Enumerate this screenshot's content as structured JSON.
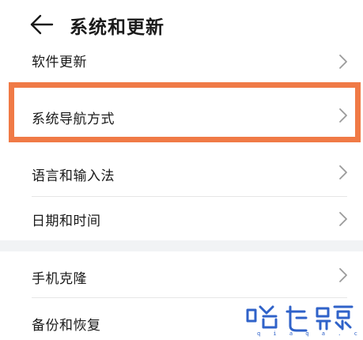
{
  "header": {
    "title": "系统和更新",
    "back_icon": "arrow-left-icon"
  },
  "items": [
    {
      "label": "软件更新",
      "icon": "chevron-right-icon"
    },
    {
      "label": "系统导航方式",
      "icon": "chevron-right-icon",
      "highlighted": true
    },
    {
      "label": "语言和输入法",
      "icon": "chevron-right-icon"
    },
    {
      "label": "日期和时间",
      "icon": "chevron-right-icon"
    },
    {
      "label": "手机克隆",
      "icon": "chevron-right-icon"
    },
    {
      "label": "备份和恢复",
      "icon": "chevron-right-icon"
    }
  ],
  "watermark": {
    "brand": "哈卡籁",
    "url": "qiaqa.com"
  },
  "colors": {
    "highlight": "#f07a46",
    "watermark": "#2f62c9",
    "section_gap": "#f1f3f5"
  }
}
